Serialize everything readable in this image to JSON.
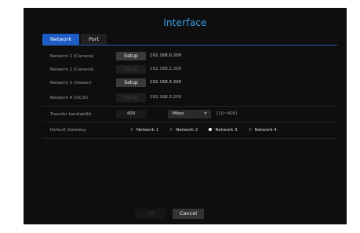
{
  "dialog": {
    "title": "Interface"
  },
  "tabs": [
    {
      "label": "Network",
      "active": true
    },
    {
      "label": "Port",
      "active": false
    }
  ],
  "networks": [
    {
      "label": "Network 1 (Camera)",
      "button": "Setup",
      "enabled": true,
      "ip": "192.168.0.200"
    },
    {
      "label": "Network 2 (Camera)",
      "button": "Setup",
      "enabled": false,
      "ip": "192.168.2.200"
    },
    {
      "label": "Network 3 (Viewer)",
      "button": "Setup",
      "enabled": true,
      "ip": "192.168.4.200"
    },
    {
      "label": "Network 4 (iSCSI)",
      "button": "Setup",
      "enabled": false,
      "ip": "192.168.3.200"
    }
  ],
  "bandwidth": {
    "label": "Transfer bandwidth",
    "value": "400",
    "unit": "Mbps",
    "range": "(10~400)"
  },
  "gateway": {
    "label": "Default Gateway",
    "options": [
      {
        "label": "Network 1",
        "checked": false
      },
      {
        "label": "Network 2",
        "checked": false
      },
      {
        "label": "Network 3",
        "checked": true
      },
      {
        "label": "Network 4",
        "checked": false
      }
    ]
  },
  "footer": {
    "ok_label": "OK",
    "cancel_label": "Cancel"
  },
  "colors": {
    "accent": "#3aa0e8",
    "active_tab": "#1e5cc8",
    "background": "#0e0e0e"
  }
}
